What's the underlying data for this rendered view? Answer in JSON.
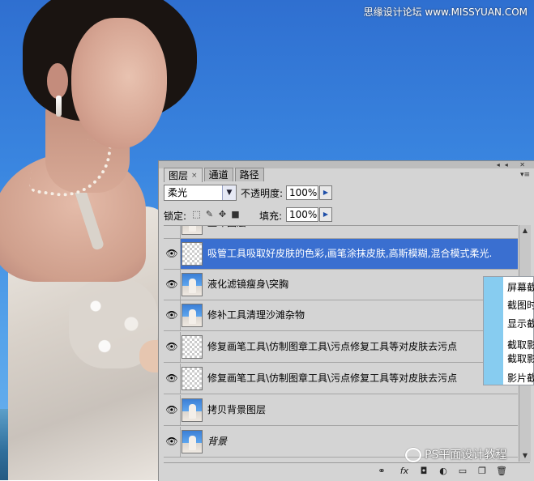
{
  "watermark_top": "思缘设计论坛 www.MISSYUAN.COM",
  "panel": {
    "tabs": [
      {
        "label": "图层",
        "close": "×"
      },
      {
        "label": "通道"
      },
      {
        "label": "路径"
      }
    ],
    "blend_mode": "柔光",
    "opacity_label": "不透明度:",
    "opacity_value": "100%",
    "lock_label": "锁定:",
    "fill_label": "填充:",
    "fill_value": "100%",
    "layers": [
      {
        "name": "盖印图层.",
        "visible": false,
        "thumb": "pic"
      },
      {
        "name": "吸管工具吸取好皮肤的色彩,画笔涂抹皮肤,高斯模糊,混合模式柔光.",
        "visible": true,
        "thumb": "trans",
        "selected": true
      },
      {
        "name": "液化滤镜瘦身\\突胸",
        "visible": true,
        "thumb": "pic"
      },
      {
        "name": "修补工具清理沙滩杂物",
        "visible": true,
        "thumb": "pic"
      },
      {
        "name": "修复画笔工具\\仿制图章工具\\污点修复工具等对皮肤去污点",
        "visible": true,
        "thumb": "trans"
      },
      {
        "name": "修复画笔工具\\仿制图章工具\\污点修复工具等对皮肤去污点",
        "visible": true,
        "thumb": "trans"
      },
      {
        "name": "拷贝背景图层",
        "visible": true,
        "thumb": "pic"
      },
      {
        "name": "背景",
        "visible": true,
        "thumb": "pic",
        "italic": true
      }
    ]
  },
  "popup": {
    "items": [
      "屏幕截",
      "截图时",
      "显示截",
      "截取影",
      "截取影",
      "影片截"
    ]
  },
  "watermark_bottom": "PS平面设计教程"
}
